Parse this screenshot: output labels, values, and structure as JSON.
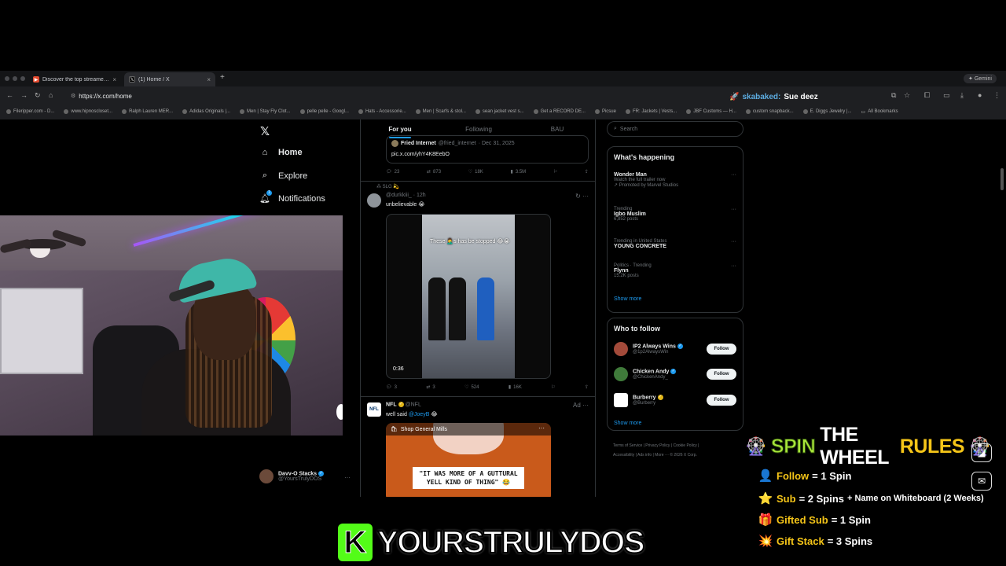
{
  "browser": {
    "tabs": [
      {
        "title": "Discover the top streamed m",
        "icon": "red-brand-icon"
      },
      {
        "title": "(1) Home / X",
        "icon": "x-icon"
      }
    ],
    "gemini_label": "Gemini",
    "url": "https://x.com/home",
    "bookmarks": [
      "Fileripper.com - D...",
      "www.hipnoscloset...",
      "Ralph Lauren MER...",
      "Adidas Originals |...",
      "Men | Stay Fly Clot...",
      "pelle pelle - Googl...",
      "Hats - Accessorie...",
      "Men | Scarfs & stol...",
      "sean jacket vest s...",
      "Get a RECORD DE...",
      "Picsue",
      "FR: Jackets | Vests...",
      "JBF Customs — H...",
      "custom snapback...",
      "E. Diggs Jewelry |..."
    ],
    "all_bookmarks": "All Bookmarks"
  },
  "chat_overlay": {
    "user": "skabaked:",
    "message": "Sue deez"
  },
  "x": {
    "nav": [
      {
        "label": "Home",
        "icon": "home-icon"
      },
      {
        "label": "Explore",
        "icon": "search-icon"
      },
      {
        "label": "Notifications",
        "icon": "bell-icon",
        "badge": "1"
      }
    ],
    "account": {
      "name": "Davv-O Stacks",
      "handle": "@YoursTrulyDOS"
    },
    "feed_tabs": [
      "For you",
      "Following",
      "BAU"
    ],
    "quote": {
      "author": "Fried Internet",
      "handle": "@fried_internet",
      "date": "· Dec 31, 2025",
      "link": "pic.x.com/yhY4K8EebO"
    },
    "post1_stats": {
      "replies": "23",
      "reposts": "873",
      "likes": "18K",
      "views": "3.5M"
    },
    "post2": {
      "context": "SLG 💫",
      "handle": "@durkkiii_",
      "time": "· 12h",
      "text": "unbelievable 😭",
      "video_caption": "These 🤦‍♂️s has be stopped 😂😭",
      "duration": "0:36",
      "stats": {
        "replies": "3",
        "reposts": "3",
        "likes": "524",
        "views": "16K"
      }
    },
    "post3": {
      "name": "NFL",
      "handle": "@NFL",
      "ad": "Ad",
      "text_prefix": "well said",
      "mention": "@JoeyB",
      "emoji": "😂",
      "shop": "Shop General Mills",
      "quote_text": "\"IT WAS MORE OF A GUTTURAL YELL KIND OF THING\" 😂"
    },
    "search_placeholder": "Search",
    "happening_title": "What's happening",
    "trends": [
      {
        "title": "Wonder Man",
        "line2": "Watch the full trailer now",
        "line3": "Promoted by Marvel Studios"
      },
      {
        "context": "Trending",
        "title": "Igbo Muslim",
        "count": "6,852 posts"
      },
      {
        "context": "Trending in United States",
        "title": "YOUNG CONCRETE"
      },
      {
        "context": "Politics · Trending",
        "title": "Flynn",
        "count": "15.2K posts"
      }
    ],
    "show_more": "Show more",
    "who_to_follow_title": "Who to follow",
    "follow_suggestions": [
      {
        "name": "IP2 Always Wins",
        "handle": "@1p2AlwaysWin",
        "verified": "blue"
      },
      {
        "name": "Chicken Andy",
        "handle": "@ChickenAndy_",
        "verified": "blue"
      },
      {
        "name": "Burberry",
        "handle": "@Burberry",
        "verified": "gold"
      }
    ],
    "follow_label": "Follow",
    "footer_row1": "Terms of Service  |  Privacy Policy  |  Cookie Policy  |",
    "footer_row2": "Accessibility  |  Ads info  |  More ···  © 2026 X Corp."
  },
  "spin_rules": {
    "title_w1": "SPIN",
    "title_w2": "THE WHEEL",
    "title_w3": "RULES",
    "rules": [
      {
        "icon": "👤",
        "lead": "Follow",
        "rest": " = 1 Spin"
      },
      {
        "icon": "⭐",
        "lead": "Sub",
        "rest": " = 2 Spins",
        "extra": " + Name on Whiteboard (2 Weeks)"
      },
      {
        "icon": "🎁",
        "lead": "Gifted Sub",
        "rest": " = 1 Spin"
      },
      {
        "icon": "💥",
        "lead": "Gift Stack",
        "rest": " = 3 Spins"
      }
    ]
  },
  "banner": {
    "logo_letter": "K",
    "name": "YOURSTRULYDOS"
  },
  "colors": {
    "x_blue": "#1d9bf0",
    "kick_green": "#53fc18",
    "rules_yellow": "#f5c518"
  }
}
